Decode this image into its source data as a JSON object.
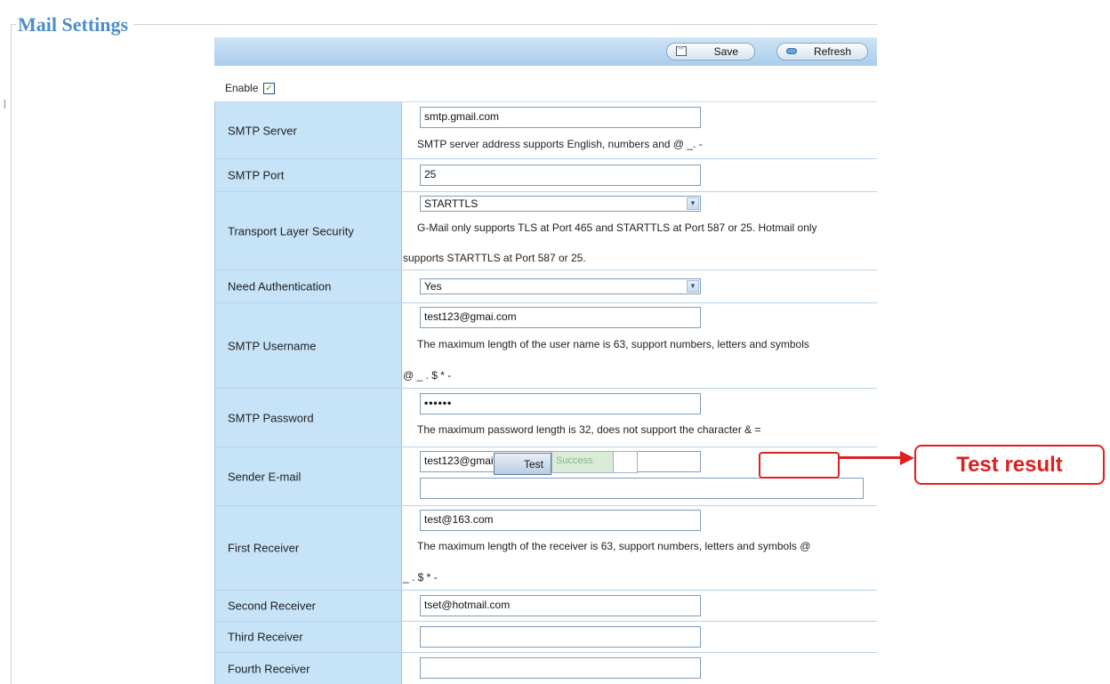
{
  "legend": "Mail Settings",
  "toolbar": {
    "save_label": "Save",
    "refresh_label": "Refresh"
  },
  "enable": {
    "label": "Enable",
    "checked": true,
    "check_glyph": "✓"
  },
  "smtp_server": {
    "label": "SMTP Server",
    "value": "smtp.gmail.com",
    "hint": "SMTP server address supports English, numbers and @ _. -"
  },
  "smtp_port": {
    "label": "SMTP Port",
    "value": "25"
  },
  "tls": {
    "label": "Transport Layer Security",
    "selected": "STARTTLS",
    "hint_line1": "G-Mail only supports TLS at Port 465 and STARTTLS at Port 587 or 25. Hotmail only",
    "hint_line2": "supports STARTTLS at Port 587 or 25."
  },
  "need_auth": {
    "label": "Need Authentication",
    "selected": "Yes"
  },
  "smtp_username": {
    "label": "SMTP Username",
    "value": "test123@gmai.com",
    "hint_line1": "The maximum length of the user name is 63, support numbers, letters and symbols",
    "hint_line2": "@ _ . $ * -"
  },
  "smtp_password": {
    "label": "SMTP Password",
    "value": "••••••",
    "hint": "The maximum password length is 32, does not support the character & ="
  },
  "sender": {
    "label": "Sender E-mail",
    "value": "test123@gmai.com",
    "test_label": "Test",
    "result": "Success"
  },
  "first_receiver": {
    "label": "First Receiver",
    "value": "test@163.com",
    "hint_line1": "The maximum length of the receiver is 63, support numbers, letters and symbols @",
    "hint_line2": "_ . $ * -"
  },
  "second_receiver": {
    "label": "Second Receiver",
    "value": "tset@hotmail.com"
  },
  "third_receiver": {
    "label": "Third Receiver",
    "value": ""
  },
  "fourth_receiver": {
    "label": "Fourth Receiver",
    "value": ""
  },
  "annotation": {
    "callout": "Test result",
    "color": "#e02020"
  },
  "colors": {
    "accent": "#4e8dc8",
    "label_bg": "#c6e3f8",
    "toolbar_bg": "#a9cdeb"
  }
}
